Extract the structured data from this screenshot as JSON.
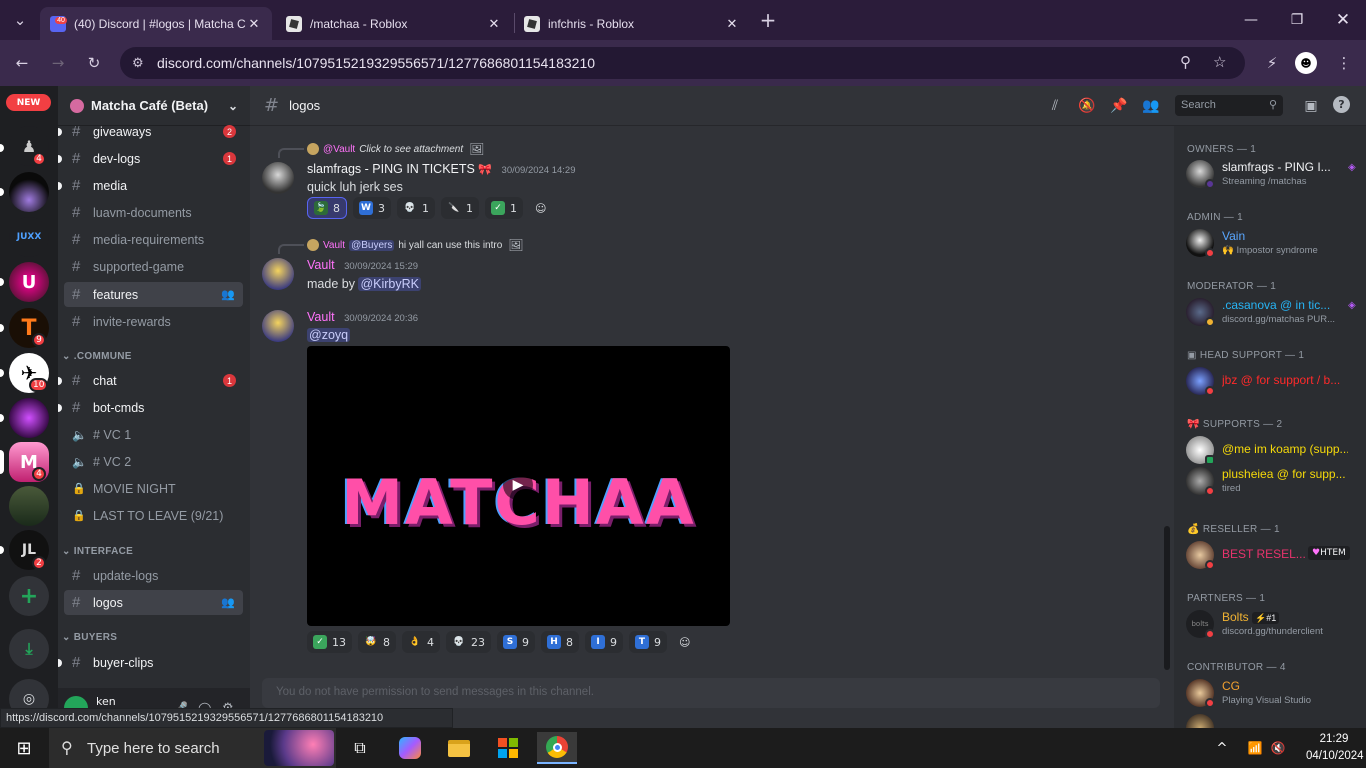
{
  "browser": {
    "tabs": [
      {
        "title": "(40) Discord | #logos | Matcha C",
        "badge": "40",
        "active": true
      },
      {
        "title": "/matchaa - Roblox",
        "active": false
      },
      {
        "title": "infchris - Roblox",
        "active": false
      }
    ],
    "url": "discord.com/channels/1079515219329556571/1277686801154183210",
    "hover_url": "https://discord.com/channels/1079515219329556571/1277686801154183210"
  },
  "server": {
    "new_badge": "NEW",
    "name": "Matcha Café (Beta)",
    "guild_badges": [
      "4",
      "9",
      "10",
      "4",
      "2"
    ],
    "guild_label": "JUXX",
    "channels_top": [
      {
        "name": "giveaways",
        "badge": "2",
        "unread": true
      },
      {
        "name": "dev-logs",
        "badge": "1",
        "unread": true
      },
      {
        "name": "media",
        "unread": true
      },
      {
        "name": "luavm-documents"
      },
      {
        "name": "media-requirements"
      },
      {
        "name": "supported-game"
      },
      {
        "name": "features",
        "selected": true
      },
      {
        "name": "invite-rewards"
      }
    ],
    "categories": [
      ".COMMUNE",
      "INTERFACE",
      "BUYERS"
    ],
    "channels_commune": [
      {
        "name": "chat",
        "badge": "1",
        "unread": true,
        "type": "text"
      },
      {
        "name": "bot-cmds",
        "unread": true,
        "type": "text"
      },
      {
        "name": "# VC 1",
        "type": "voice"
      },
      {
        "name": "# VC 2",
        "type": "voice"
      },
      {
        "name": "MOVIE NIGHT",
        "type": "locked"
      },
      {
        "name": "LAST TO LEAVE (9/21)",
        "type": "locked"
      }
    ],
    "channels_interface": [
      {
        "name": "update-logs"
      },
      {
        "name": "logos",
        "selected": true
      }
    ],
    "channels_buyers": [
      {
        "name": "buyer-clips",
        "unread": true
      }
    ],
    "user": {
      "name": "ken"
    }
  },
  "channel": {
    "name": "logos",
    "search_placeholder": "Search",
    "composer_placeholder": "You do not have permission to send messages in this channel."
  },
  "messages": [
    {
      "reply_user": "@Vault",
      "reply_text": "Click to see attachment",
      "author": "slamfrags",
      "author_tag": " - PING IN TICKETS",
      "timestamp": "30/09/2024 14:29",
      "text": "quick luh jerk ses",
      "reactions": [
        {
          "emoji": "leaf",
          "count": "8",
          "me": true
        },
        {
          "emoji": "W",
          "count": "3"
        },
        {
          "emoji": "skull",
          "count": "1"
        },
        {
          "emoji": "knife",
          "count": "1"
        },
        {
          "emoji": "check",
          "count": "1"
        }
      ]
    },
    {
      "reply_user": "Vault",
      "reply_mention": "@Buyers",
      "reply_text": "hi yall can use this intro",
      "author": "Vault",
      "timestamp": "30/09/2024 15:29",
      "text": "made by",
      "mention": "@KirbyRK"
    },
    {
      "author": "Vault",
      "timestamp": "30/09/2024 20:36",
      "mention": "@zoyq",
      "video_title": "MATCHAA",
      "reactions": [
        {
          "emoji": "check",
          "count": "13"
        },
        {
          "emoji": "mindblown",
          "count": "8"
        },
        {
          "emoji": "ok",
          "count": "4"
        },
        {
          "emoji": "skull",
          "count": "23"
        },
        {
          "emoji": "S",
          "count": "9"
        },
        {
          "emoji": "H",
          "count": "8"
        },
        {
          "emoji": "I",
          "count": "9"
        },
        {
          "emoji": "T",
          "count": "9"
        }
      ]
    }
  ],
  "members": {
    "groups": [
      {
        "role": "OWNERS — 1",
        "members": [
          {
            "name": "slamfrags - PING I...",
            "sub": "Streaming /matchas",
            "color": "#f2f3f5"
          }
        ]
      },
      {
        "role": "ADMIN — 1",
        "members": [
          {
            "name": "Vain",
            "sub": "🙌 Impostor syndrome",
            "color": "#5aa7ff"
          }
        ]
      },
      {
        "role": "MODERATOR — 1",
        "members": [
          {
            "name": ".casanova @ in tic...",
            "sub": "discord.gg/matchas PUR...",
            "color": "#27b4f5"
          }
        ]
      },
      {
        "role": "HEAD SUPPORT — 1",
        "members": [
          {
            "name": "jbz @ for support / b...",
            "sub": "",
            "color": "#ff2a2a"
          }
        ]
      },
      {
        "role": "SUPPORTS — 2",
        "members": [
          {
            "name": "@me im koamp (supp...",
            "sub": "",
            "color": "#f5d90a"
          },
          {
            "name": "plusheiea @ for supp...",
            "sub": "tired",
            "color": "#f5d90a"
          }
        ]
      },
      {
        "role": "RESELLER — 1",
        "members": [
          {
            "name": "BEST RESEL...",
            "sub": "",
            "tag": "HTEM",
            "color": "#e8336d"
          }
        ]
      },
      {
        "role": "PARTNERS — 1",
        "members": [
          {
            "name": "Bolts",
            "tag": "#1",
            "sub": "discord.gg/thunderclient",
            "color": "#f0b232"
          }
        ]
      },
      {
        "role": "CONTRIBUTOR — 4",
        "members": [
          {
            "name": "CG",
            "sub": "Playing Visual Studio",
            "color": "#f0a030"
          }
        ]
      }
    ]
  },
  "taskbar": {
    "search_placeholder": "Type here to search",
    "time": "21:29",
    "date": "04/10/2024"
  }
}
